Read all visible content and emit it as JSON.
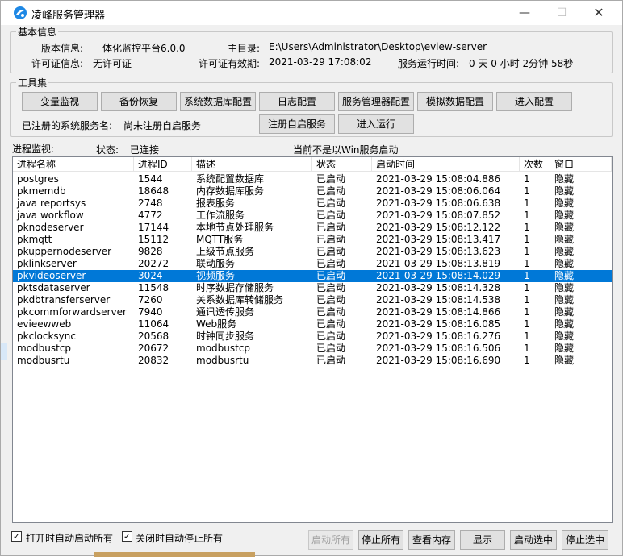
{
  "window": {
    "title": "凌峰服务管理器",
    "min_glyph": "—",
    "max_glyph": "☐",
    "close_glyph": "✕"
  },
  "basic_info": {
    "group_title": "基本信息",
    "version_label": "版本信息:",
    "version_value": "一体化监控平台6.0.0",
    "main_dir_label": "主目录:",
    "main_dir_value": "E:\\Users\\Administrator\\Desktop\\eview-server",
    "license_label": "许可证信息:",
    "license_value": "无许可证",
    "license_expiry_label": "许可证有效期:",
    "license_expiry_value": "2021-03-29 17:08:02",
    "uptime_label": "服务运行时间:",
    "uptime_value": "0 天 0 小时 2分钟 58秒"
  },
  "toolbox": {
    "group_title": "工具集",
    "buttons": [
      "变量监视",
      "备份恢复",
      "系统数据库配置",
      "日志配置",
      "服务管理器配置",
      "模拟数据配置",
      "进入配置"
    ],
    "registered_label": "已注册的系统服务名:",
    "registered_value": "尚未注册自启服务",
    "register_button": "注册自启服务",
    "run_button": "进入运行"
  },
  "monitor": {
    "label": "进程监视:",
    "status_label": "状态:",
    "status_value": "已连接",
    "win_service_note": "当前不是以Win服务启动"
  },
  "table": {
    "columns": [
      "进程名称",
      "进程ID",
      "描述",
      "状态",
      "启动时间",
      "次数",
      "窗口"
    ],
    "rows": [
      [
        "postgres",
        "1544",
        "系统配置数据库",
        "已启动",
        "2021-03-29 15:08:04.886",
        "1",
        "隐藏"
      ],
      [
        "pkmemdb",
        "18648",
        "内存数据库服务",
        "已启动",
        "2021-03-29 15:08:06.064",
        "1",
        "隐藏"
      ],
      [
        "java reportsys",
        "2748",
        "报表服务",
        "已启动",
        "2021-03-29 15:08:06.638",
        "1",
        "隐藏"
      ],
      [
        "java workflow",
        "4772",
        "工作流服务",
        "已启动",
        "2021-03-29 15:08:07.852",
        "1",
        "隐藏"
      ],
      [
        "pknodeserver",
        "17144",
        "本地节点处理服务",
        "已启动",
        "2021-03-29 15:08:12.122",
        "1",
        "隐藏"
      ],
      [
        "pkmqtt",
        "15112",
        "MQTT服务",
        "已启动",
        "2021-03-29 15:08:13.417",
        "1",
        "隐藏"
      ],
      [
        "pkuppernodeserver",
        "9828",
        "上级节点服务",
        "已启动",
        "2021-03-29 15:08:13.623",
        "1",
        "隐藏"
      ],
      [
        "pklinkserver",
        "20272",
        "联动服务",
        "已启动",
        "2021-03-29 15:08:13.819",
        "1",
        "隐藏"
      ],
      [
        "pkvideoserver",
        "3024",
        "视频服务",
        "已启动",
        "2021-03-29 15:08:14.029",
        "1",
        "隐藏"
      ],
      [
        "pktsdataserver",
        "11548",
        "时序数据存储服务",
        "已启动",
        "2021-03-29 15:08:14.328",
        "1",
        "隐藏"
      ],
      [
        "pkdbtransferserver",
        "7260",
        "关系数据库转储服务",
        "已启动",
        "2021-03-29 15:08:14.538",
        "1",
        "隐藏"
      ],
      [
        "pkcommforwardserver",
        "7940",
        "通讯透传服务",
        "已启动",
        "2021-03-29 15:08:14.866",
        "1",
        "隐藏"
      ],
      [
        "evieewweb",
        "11064",
        "Web服务",
        "已启动",
        "2021-03-29 15:08:16.085",
        "1",
        "隐藏"
      ],
      [
        "pkclocksync",
        "20568",
        "时钟同步服务",
        "已启动",
        "2021-03-29 15:08:16.276",
        "1",
        "隐藏"
      ],
      [
        "modbustcp",
        "20672",
        "modbustcp",
        "已启动",
        "2021-03-29 15:08:16.506",
        "1",
        "隐藏"
      ],
      [
        "modbusrtu",
        "20832",
        "modbusrtu",
        "已启动",
        "2021-03-29 15:08:16.690",
        "1",
        "隐藏"
      ]
    ],
    "selected_row": 8
  },
  "footer": {
    "auto_start_label": "打开时自动启动所有",
    "auto_stop_label": "关闭时自动停止所有",
    "check_glyph": "✓",
    "buttons": [
      "启动所有",
      "停止所有",
      "查看内存",
      "显示",
      "启动选中",
      "停止选中"
    ]
  },
  "colors": {
    "selection": "#0078d7",
    "window_bg": "#f0f0f0"
  }
}
